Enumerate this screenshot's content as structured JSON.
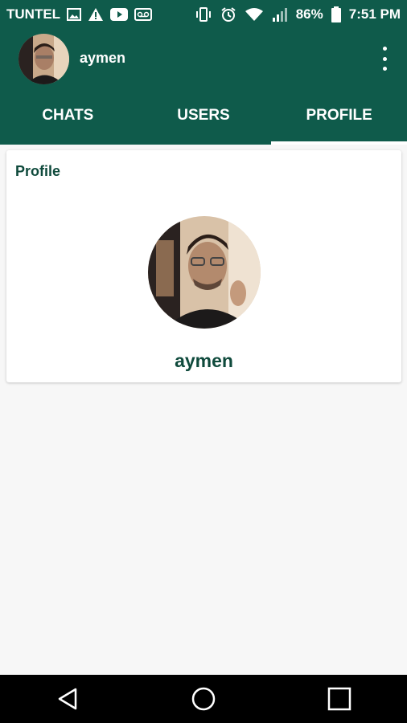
{
  "status_bar": {
    "carrier": "TUNTEL",
    "battery": "86%",
    "time": "7:51 PM"
  },
  "app_bar": {
    "username": "aymen"
  },
  "tabs": [
    {
      "label": "CHATS",
      "active": false
    },
    {
      "label": "USERS",
      "active": false
    },
    {
      "label": "PROFILE",
      "active": true
    }
  ],
  "profile_card": {
    "title": "Profile",
    "name": "aymen"
  },
  "colors": {
    "primary": "#0f5b4b",
    "text_dark_green": "#0f4a3c",
    "background": "#f7f7f7"
  }
}
